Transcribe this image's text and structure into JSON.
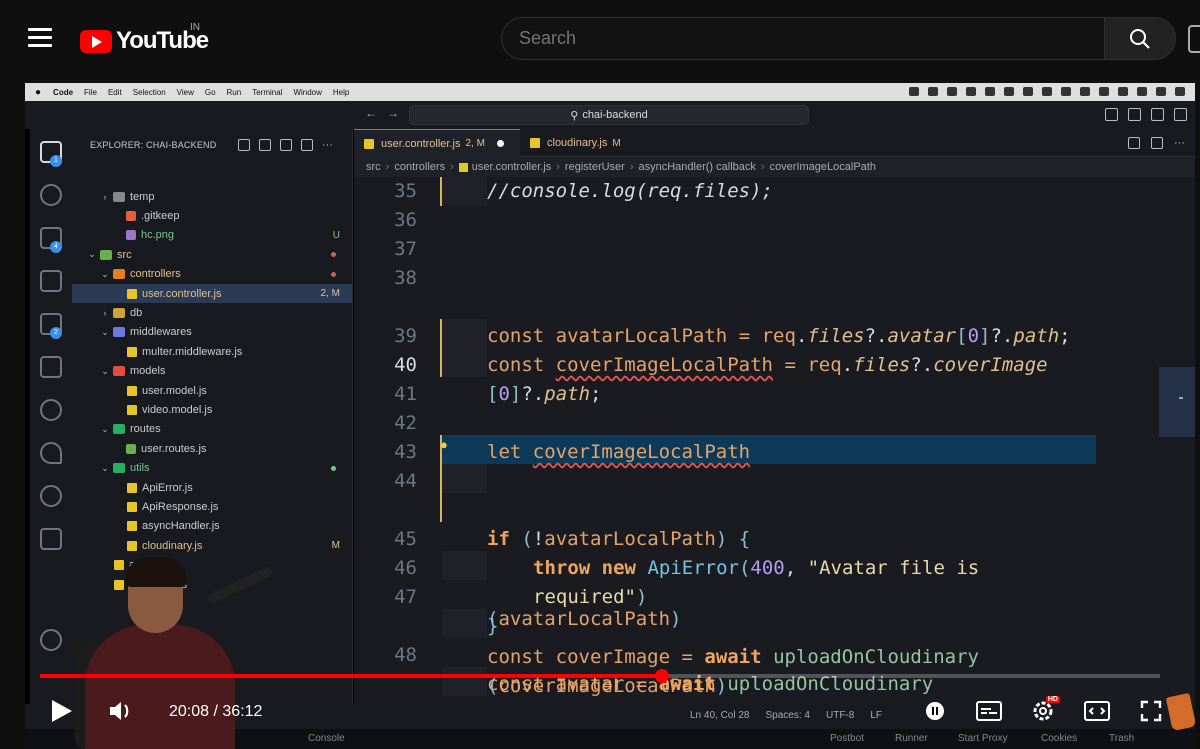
{
  "youtube": {
    "logo_text": "YouTube",
    "region": "IN",
    "search_placeholder": "Search"
  },
  "macbar": {
    "app": "Code",
    "menus": [
      "File",
      "Edit",
      "Selection",
      "View",
      "Go",
      "Run",
      "Terminal",
      "Window",
      "Help"
    ]
  },
  "vscode": {
    "command_center": "chai-backend",
    "explorer_title": "EXPLORER: CHAI-BACKEND",
    "activity_badges": [
      "1",
      "4",
      "2"
    ],
    "tree": [
      {
        "name": "temp",
        "kind": "folder",
        "depth": 2,
        "status": ""
      },
      {
        "name": ".gitkeep",
        "kind": "file-git",
        "depth": 3,
        "status": ""
      },
      {
        "name": "hc.png",
        "kind": "file-img",
        "depth": 3,
        "status": "U"
      },
      {
        "name": "src",
        "kind": "folder-open",
        "depth": 1,
        "status": "dot"
      },
      {
        "name": "controllers",
        "kind": "folder-open",
        "depth": 2,
        "status": "dot"
      },
      {
        "name": "user.controller.js",
        "kind": "js",
        "depth": 3,
        "status": "2, M",
        "selected": true
      },
      {
        "name": "db",
        "kind": "folder",
        "depth": 2,
        "status": ""
      },
      {
        "name": "middlewares",
        "kind": "folder-open",
        "depth": 2,
        "status": ""
      },
      {
        "name": "multer.middleware.js",
        "kind": "js",
        "depth": 3,
        "status": ""
      },
      {
        "name": "models",
        "kind": "folder-open",
        "depth": 2,
        "status": ""
      },
      {
        "name": "user.model.js",
        "kind": "js",
        "depth": 3,
        "status": ""
      },
      {
        "name": "video.model.js",
        "kind": "js",
        "depth": 3,
        "status": ""
      },
      {
        "name": "routes",
        "kind": "folder-open",
        "depth": 2,
        "status": ""
      },
      {
        "name": "user.routes.js",
        "kind": "route",
        "depth": 3,
        "status": ""
      },
      {
        "name": "utils",
        "kind": "folder-open",
        "depth": 2,
        "status": "dot-green"
      },
      {
        "name": "ApiError.js",
        "kind": "js",
        "depth": 3,
        "status": ""
      },
      {
        "name": "ApiResponse.js",
        "kind": "js",
        "depth": 3,
        "status": ""
      },
      {
        "name": "asyncHandler.js",
        "kind": "js",
        "depth": 3,
        "status": ""
      },
      {
        "name": "cloudinary.js",
        "kind": "js",
        "depth": 3,
        "status": "M"
      },
      {
        "name": "app.js",
        "kind": "js",
        "depth": 2,
        "status": ""
      },
      {
        "name": "constants.js",
        "kind": "js",
        "depth": 2,
        "status": ""
      }
    ],
    "tabs": [
      {
        "label": "user.controller.js",
        "status": "2, M",
        "active": true
      },
      {
        "label": "cloudinary.js",
        "status": "M",
        "active": false
      }
    ],
    "breadcrumb": [
      "src",
      "controllers",
      "user.controller.js",
      "registerUser",
      "asyncHandler() callback",
      "coverImageLocalPath"
    ],
    "line_numbers": [
      "35",
      "36",
      "37",
      "38",
      "",
      "39",
      "40",
      "41",
      "42",
      "43",
      "44",
      "",
      "45",
      "46",
      "47",
      "",
      "48",
      ""
    ],
    "current_line": "40",
    "status": {
      "position": "Ln 40, Col 28",
      "spaces": "Spaces: 4",
      "encoding": "UTF-8",
      "eol": "LF"
    },
    "panel": {
      "console": "Console",
      "postbot": "Postbot",
      "runner": "Runner",
      "proxy": "Start Proxy",
      "cookies": "Cookies",
      "trash": "Trash"
    }
  },
  "player": {
    "current_time": "20:08",
    "separator": "/",
    "duration": "36:12",
    "progress": 0.5557,
    "hd_badge": "HD"
  }
}
